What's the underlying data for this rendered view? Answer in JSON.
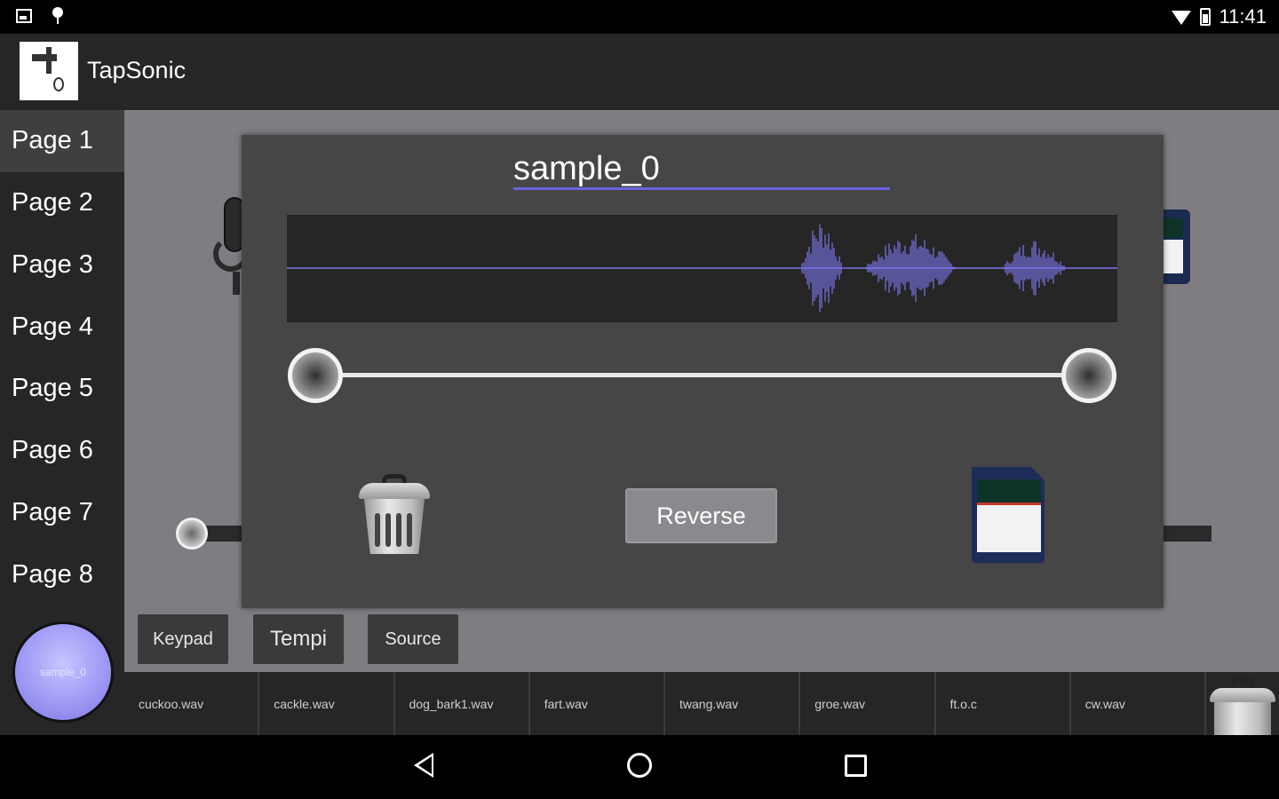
{
  "status_bar": {
    "time": "11:41"
  },
  "app": {
    "title": "TapSonic"
  },
  "sidebar": {
    "items": [
      {
        "label": "Page 1"
      },
      {
        "label": "Page 2"
      },
      {
        "label": "Page 3"
      },
      {
        "label": "Page 4"
      },
      {
        "label": "Page 5"
      },
      {
        "label": "Page 6"
      },
      {
        "label": "Page 7"
      },
      {
        "label": "Page 8"
      }
    ]
  },
  "dialog": {
    "sample_name": "sample_0",
    "reverse_label": "Reverse",
    "trim_start": 0.0,
    "trim_end": 1.0
  },
  "modes": {
    "keypad": "Keypad",
    "tempi": "Tempi",
    "source": "Source"
  },
  "current_sample": {
    "label": "sample_0"
  },
  "files": [
    "cuckoo.wav",
    "cackle.wav",
    "dog_bark1.wav",
    "fart.wav",
    "twang.wav",
    "groe.wav",
    "ft.o.c",
    "cw.wav"
  ],
  "colors": {
    "accent": "#6a64e0",
    "waveform": "#7a74e8",
    "sample_button": "#9f9af5"
  }
}
